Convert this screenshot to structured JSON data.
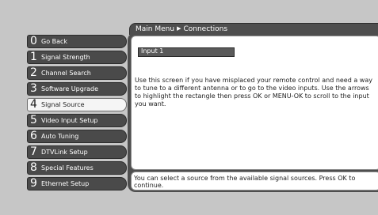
{
  "breadcrumb": {
    "root": "Main Menu",
    "current": "Connections"
  },
  "menu": [
    {
      "num": "0",
      "label": "Go Back",
      "selected": false
    },
    {
      "num": "1",
      "label": "Signal Strength",
      "selected": false
    },
    {
      "num": "2",
      "label": "Channel Search",
      "selected": false
    },
    {
      "num": "3",
      "label": "Software Upgrade",
      "selected": false
    },
    {
      "num": "4",
      "label": "Signal Source",
      "selected": true
    },
    {
      "num": "5",
      "label": "Video Input Setup",
      "selected": false
    },
    {
      "num": "6",
      "label": "Auto Tuning",
      "selected": false
    },
    {
      "num": "7",
      "label": "DTVLink Setup",
      "selected": false
    },
    {
      "num": "8",
      "label": "Special Features",
      "selected": false
    },
    {
      "num": "9",
      "label": "Ethernet Setup",
      "selected": false
    }
  ],
  "content": {
    "input_label": "Input 1",
    "description": "Use this screen if you have misplaced your remote control and need a way to tune to a different antenna or to go to the video inputs. Use the arrows to highlight the rectangle then press OK or MENU-OK to scroll to the input you want.",
    "help": "You can select a source from the available signal sources. Press OK to continue."
  }
}
